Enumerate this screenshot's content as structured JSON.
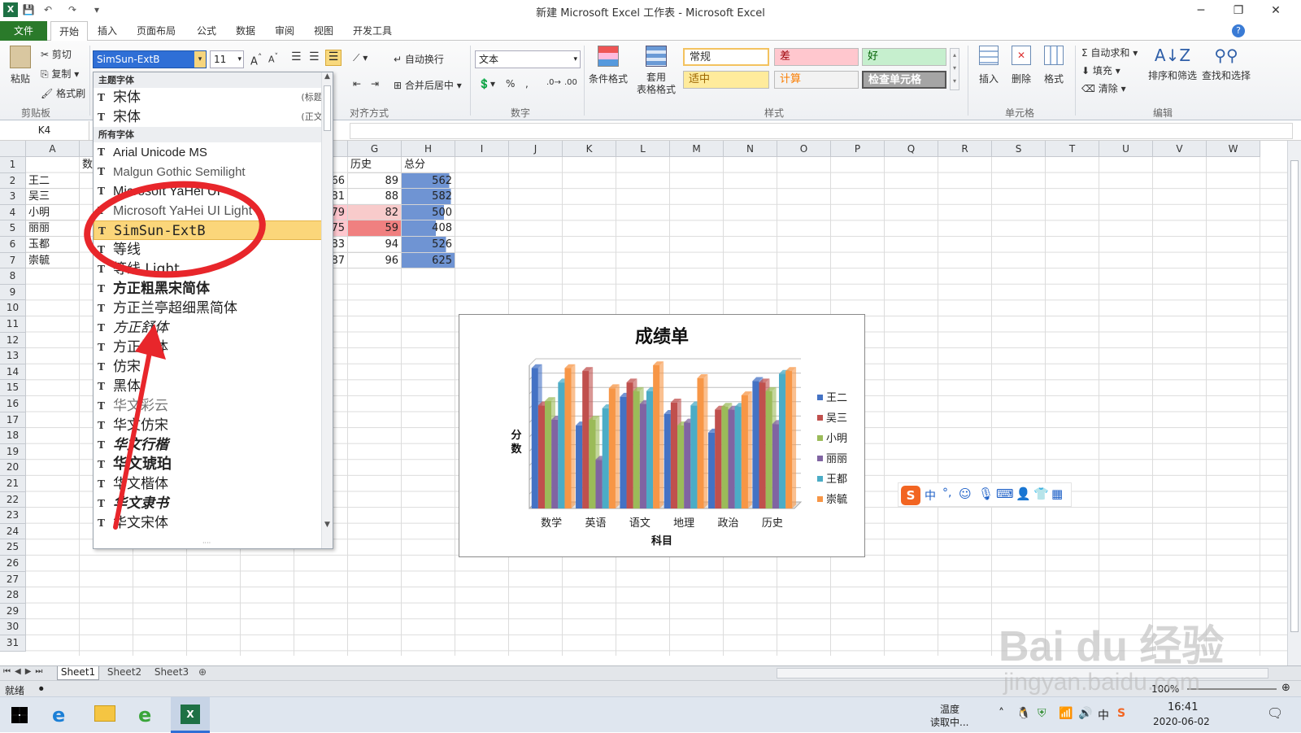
{
  "window": {
    "title": "新建 Microsoft Excel 工作表 - Microsoft Excel",
    "minimize": "─",
    "restore": "❐",
    "close": "✕"
  },
  "quick_access": {
    "save_icon": "save-icon",
    "undo_icon": "undo-icon",
    "redo_icon": "redo-icon"
  },
  "menu": {
    "file": "文件",
    "tabs": [
      "开始",
      "插入",
      "页面布局",
      "公式",
      "数据",
      "审阅",
      "视图",
      "开发工具"
    ],
    "active": "开始"
  },
  "ribbon": {
    "clipboard": {
      "paste": "粘贴",
      "cut": "剪切",
      "copy": "复制",
      "format_painter": "格式刷",
      "group": "剪贴板"
    },
    "font": {
      "name": "SimSun-ExtB",
      "size": "11"
    },
    "alignment": {
      "wrap": "自动换行",
      "merge": "合并后居中",
      "group": "对齐方式"
    },
    "number": {
      "format": "文本",
      "percent": "%",
      "comma": ",",
      "group": "数字"
    },
    "styles": {
      "conditional": "条件格式",
      "table_format": "套用\n表格格式",
      "cells": [
        {
          "label": "常规",
          "bg": "#ffffff",
          "fg": "#333333"
        },
        {
          "label": "差",
          "bg": "#ffc7ce",
          "fg": "#9c0006"
        },
        {
          "label": "好",
          "bg": "#c6efce",
          "fg": "#006100"
        },
        {
          "label": "适中",
          "bg": "#ffeb9c",
          "fg": "#9c6500"
        },
        {
          "label": "计算",
          "bg": "#f2f2f2",
          "fg": "#fa7d00"
        },
        {
          "label": "检查单元格",
          "bg": "#a5a5a5",
          "fg": "#ffffff"
        }
      ],
      "group": "样式"
    },
    "cells_group": {
      "insert": "插入",
      "delete": "删除",
      "format": "格式",
      "group": "单元格"
    },
    "editing": {
      "autosum": "自动求和",
      "fill": "填充",
      "clear": "清除",
      "sort": "排序和筛选",
      "find": "查找和选择",
      "group": "编辑"
    }
  },
  "font_dropdown": {
    "theme_header": "主题字体",
    "theme_fonts": [
      {
        "name": "宋体",
        "note": "(标题)"
      },
      {
        "name": "宋体",
        "note": "(正文)"
      }
    ],
    "all_header": "所有字体",
    "fonts": [
      "Arial Unicode MS",
      "Malgun Gothic Semilight",
      "Microsoft YaHei UI",
      "Microsoft YaHei UI Light",
      "SimSun-ExtB",
      "等线",
      "等线 Light",
      "方正粗黑宋简体",
      "方正兰亭超细黑简体",
      "方正舒体",
      "方正姚体",
      "仿宋",
      "黑体",
      "华文彩云",
      "华文仿宋",
      "华文行楷",
      "华文琥珀",
      "华文楷体",
      "华文隶书",
      "华文宋体"
    ],
    "selected": "SimSun-ExtB"
  },
  "name_box": "K4",
  "columns": [
    "A",
    "B",
    "C",
    "D",
    "E",
    "F",
    "G",
    "H",
    "I",
    "J",
    "K",
    "L",
    "M",
    "N",
    "O",
    "P",
    "Q",
    "R",
    "S",
    "T",
    "U",
    "V",
    "W"
  ],
  "rows": [
    "1",
    "2",
    "3",
    "4",
    "5",
    "6",
    "7",
    "8",
    "9",
    "10",
    "11",
    "12",
    "13",
    "14",
    "15",
    "16",
    "17",
    "18",
    "19",
    "20",
    "21",
    "22",
    "23",
    "24",
    "25",
    "26",
    "27",
    "28",
    "29",
    "30",
    "31"
  ],
  "sheet": {
    "header_b": "数",
    "header_g": "历史",
    "header_h": "总分",
    "names": [
      "王二",
      "吴三",
      "小明",
      "丽丽",
      "玉都",
      "崇毓"
    ],
    "col_f": [
      "66",
      "81",
      "79",
      "75",
      "83",
      "87"
    ],
    "col_g": [
      "89",
      "88",
      "82",
      "59",
      "94",
      "96"
    ],
    "col_h": [
      "562",
      "582",
      "500",
      "408",
      "526",
      "625"
    ]
  },
  "cell_colors": {
    "f_highlight": "#ffc7ce",
    "g_low_light": "#f8cbcb",
    "g_low_strong": "#f08080",
    "h_bar": "#6f94d3"
  },
  "chart_data": {
    "type": "bar",
    "title": "成绩单",
    "xlabel": "科目",
    "ylabel": "分数",
    "categories": [
      "数学",
      "英语",
      "语文",
      "地理",
      "政治",
      "历史"
    ],
    "ylim": [
      0,
      100
    ],
    "series": [
      {
        "name": "王二",
        "color": "#4472c4",
        "values": [
          98,
          58,
          78,
          66,
          53,
          89
        ]
      },
      {
        "name": "吴三",
        "color": "#c0504d",
        "values": [
          72,
          96,
          88,
          74,
          69,
          88
        ]
      },
      {
        "name": "小明",
        "color": "#9bbb59",
        "values": [
          75,
          62,
          82,
          58,
          71,
          82
        ]
      },
      {
        "name": "丽丽",
        "color": "#8064a2",
        "values": [
          62,
          34,
          73,
          60,
          69,
          59
        ]
      },
      {
        "name": "王都",
        "color": "#4bacc6",
        "values": [
          88,
          70,
          82,
          72,
          71,
          94
        ]
      },
      {
        "name": "崇毓",
        "color": "#f79646",
        "values": [
          98,
          84,
          100,
          91,
          79,
          96
        ]
      }
    ]
  },
  "sheet_tabs": [
    "Sheet1",
    "Sheet2",
    "Sheet3"
  ],
  "status": {
    "ready": "就绪",
    "zoom": "100%"
  },
  "taskbar": {
    "weather_line1": "温度",
    "weather_line2": "读取中...",
    "time": "16:41",
    "date": "2020-06-02"
  },
  "watermark": {
    "brand": "Bai du 经验",
    "url": "jingyan.baidu.com"
  },
  "colors": {
    "file_tab": "#2a7a2a",
    "highlight": "#fbd67a",
    "annotation": "#e8262b"
  }
}
